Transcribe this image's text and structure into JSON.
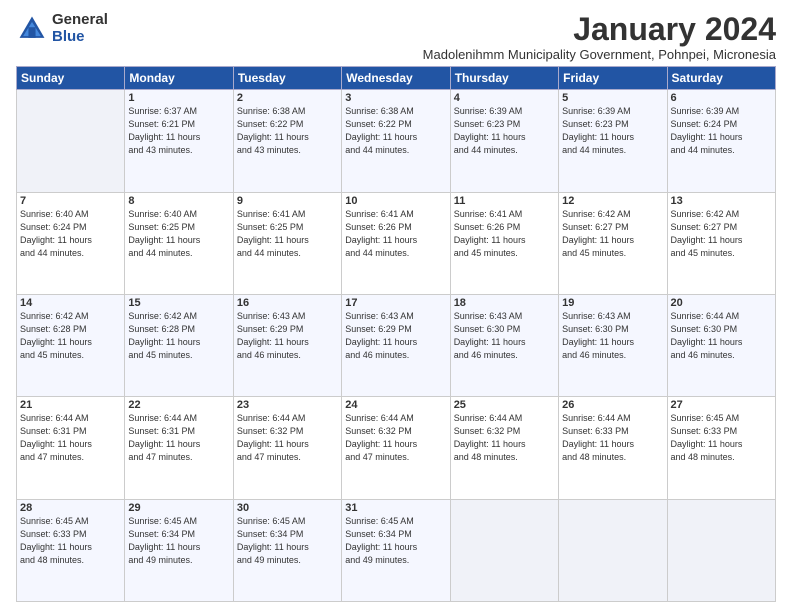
{
  "header": {
    "logo_general": "General",
    "logo_blue": "Blue",
    "title": "January 2024",
    "subtitle": "Madolenihmm Municipality Government, Pohnpei, Micronesia"
  },
  "days_of_week": [
    "Sunday",
    "Monday",
    "Tuesday",
    "Wednesday",
    "Thursday",
    "Friday",
    "Saturday"
  ],
  "weeks": [
    [
      {
        "day": "",
        "info": ""
      },
      {
        "day": "1",
        "info": "Sunrise: 6:37 AM\nSunset: 6:21 PM\nDaylight: 11 hours\nand 43 minutes."
      },
      {
        "day": "2",
        "info": "Sunrise: 6:38 AM\nSunset: 6:22 PM\nDaylight: 11 hours\nand 43 minutes."
      },
      {
        "day": "3",
        "info": "Sunrise: 6:38 AM\nSunset: 6:22 PM\nDaylight: 11 hours\nand 44 minutes."
      },
      {
        "day": "4",
        "info": "Sunrise: 6:39 AM\nSunset: 6:23 PM\nDaylight: 11 hours\nand 44 minutes."
      },
      {
        "day": "5",
        "info": "Sunrise: 6:39 AM\nSunset: 6:23 PM\nDaylight: 11 hours\nand 44 minutes."
      },
      {
        "day": "6",
        "info": "Sunrise: 6:39 AM\nSunset: 6:24 PM\nDaylight: 11 hours\nand 44 minutes."
      }
    ],
    [
      {
        "day": "7",
        "info": "Sunrise: 6:40 AM\nSunset: 6:24 PM\nDaylight: 11 hours\nand 44 minutes."
      },
      {
        "day": "8",
        "info": "Sunrise: 6:40 AM\nSunset: 6:25 PM\nDaylight: 11 hours\nand 44 minutes."
      },
      {
        "day": "9",
        "info": "Sunrise: 6:41 AM\nSunset: 6:25 PM\nDaylight: 11 hours\nand 44 minutes."
      },
      {
        "day": "10",
        "info": "Sunrise: 6:41 AM\nSunset: 6:26 PM\nDaylight: 11 hours\nand 44 minutes."
      },
      {
        "day": "11",
        "info": "Sunrise: 6:41 AM\nSunset: 6:26 PM\nDaylight: 11 hours\nand 45 minutes."
      },
      {
        "day": "12",
        "info": "Sunrise: 6:42 AM\nSunset: 6:27 PM\nDaylight: 11 hours\nand 45 minutes."
      },
      {
        "day": "13",
        "info": "Sunrise: 6:42 AM\nSunset: 6:27 PM\nDaylight: 11 hours\nand 45 minutes."
      }
    ],
    [
      {
        "day": "14",
        "info": "Sunrise: 6:42 AM\nSunset: 6:28 PM\nDaylight: 11 hours\nand 45 minutes."
      },
      {
        "day": "15",
        "info": "Sunrise: 6:42 AM\nSunset: 6:28 PM\nDaylight: 11 hours\nand 45 minutes."
      },
      {
        "day": "16",
        "info": "Sunrise: 6:43 AM\nSunset: 6:29 PM\nDaylight: 11 hours\nand 46 minutes."
      },
      {
        "day": "17",
        "info": "Sunrise: 6:43 AM\nSunset: 6:29 PM\nDaylight: 11 hours\nand 46 minutes."
      },
      {
        "day": "18",
        "info": "Sunrise: 6:43 AM\nSunset: 6:30 PM\nDaylight: 11 hours\nand 46 minutes."
      },
      {
        "day": "19",
        "info": "Sunrise: 6:43 AM\nSunset: 6:30 PM\nDaylight: 11 hours\nand 46 minutes."
      },
      {
        "day": "20",
        "info": "Sunrise: 6:44 AM\nSunset: 6:30 PM\nDaylight: 11 hours\nand 46 minutes."
      }
    ],
    [
      {
        "day": "21",
        "info": "Sunrise: 6:44 AM\nSunset: 6:31 PM\nDaylight: 11 hours\nand 47 minutes."
      },
      {
        "day": "22",
        "info": "Sunrise: 6:44 AM\nSunset: 6:31 PM\nDaylight: 11 hours\nand 47 minutes."
      },
      {
        "day": "23",
        "info": "Sunrise: 6:44 AM\nSunset: 6:32 PM\nDaylight: 11 hours\nand 47 minutes."
      },
      {
        "day": "24",
        "info": "Sunrise: 6:44 AM\nSunset: 6:32 PM\nDaylight: 11 hours\nand 47 minutes."
      },
      {
        "day": "25",
        "info": "Sunrise: 6:44 AM\nSunset: 6:32 PM\nDaylight: 11 hours\nand 48 minutes."
      },
      {
        "day": "26",
        "info": "Sunrise: 6:44 AM\nSunset: 6:33 PM\nDaylight: 11 hours\nand 48 minutes."
      },
      {
        "day": "27",
        "info": "Sunrise: 6:45 AM\nSunset: 6:33 PM\nDaylight: 11 hours\nand 48 minutes."
      }
    ],
    [
      {
        "day": "28",
        "info": "Sunrise: 6:45 AM\nSunset: 6:33 PM\nDaylight: 11 hours\nand 48 minutes."
      },
      {
        "day": "29",
        "info": "Sunrise: 6:45 AM\nSunset: 6:34 PM\nDaylight: 11 hours\nand 49 minutes."
      },
      {
        "day": "30",
        "info": "Sunrise: 6:45 AM\nSunset: 6:34 PM\nDaylight: 11 hours\nand 49 minutes."
      },
      {
        "day": "31",
        "info": "Sunrise: 6:45 AM\nSunset: 6:34 PM\nDaylight: 11 hours\nand 49 minutes."
      },
      {
        "day": "",
        "info": ""
      },
      {
        "day": "",
        "info": ""
      },
      {
        "day": "",
        "info": ""
      }
    ]
  ]
}
